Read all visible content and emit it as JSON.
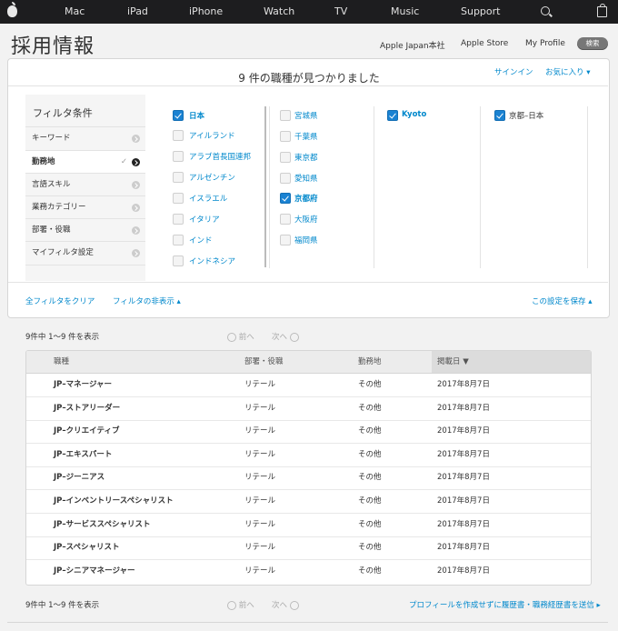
{
  "global_nav": {
    "items": [
      "Mac",
      "iPad",
      "iPhone",
      "Watch",
      "TV",
      "Music",
      "Support"
    ]
  },
  "header": {
    "title": "採用情報",
    "links": [
      "Apple Japan本社",
      "Apple Store",
      "My Profile"
    ],
    "search_button": "検索"
  },
  "results_header": {
    "count_text": "9 件の職種が見つかりました",
    "signin": "サインイン",
    "favorites": "お気に入り ▾"
  },
  "filters": {
    "title": "フィルタ条件",
    "categories": [
      {
        "label": "キーワード",
        "active": false
      },
      {
        "label": "勤務地",
        "active": true,
        "check": "✓"
      },
      {
        "label": "言語スキル",
        "active": false
      },
      {
        "label": "業務カテゴリー",
        "active": false
      },
      {
        "label": "部署・役職",
        "active": false
      },
      {
        "label": "マイフィルタ設定",
        "active": false
      }
    ],
    "countries": [
      {
        "label": "日本",
        "checked": true
      },
      {
        "label": "アイルランド",
        "checked": false
      },
      {
        "label": "アラブ首長国連邦",
        "checked": false
      },
      {
        "label": "アルゼンチン",
        "checked": false
      },
      {
        "label": "イスラエル",
        "checked": false
      },
      {
        "label": "イタリア",
        "checked": false
      },
      {
        "label": "インド",
        "checked": false
      },
      {
        "label": "インドネシア",
        "checked": false
      }
    ],
    "prefectures": [
      {
        "label": "宮城県",
        "checked": false
      },
      {
        "label": "千葉県",
        "checked": false
      },
      {
        "label": "東京都",
        "checked": false
      },
      {
        "label": "愛知県",
        "checked": false
      },
      {
        "label": "京都府",
        "checked": true
      },
      {
        "label": "大阪府",
        "checked": false
      },
      {
        "label": "福岡県",
        "checked": false
      }
    ],
    "city": {
      "label": "Kyoto",
      "checked": true
    },
    "selected": {
      "label": "京都–日本",
      "checked": true
    },
    "clear_all": "全フィルタをクリア",
    "hide_filters": "フィルタの非表示 ▴",
    "save_settings": "この設定を保存 ▴"
  },
  "pagination": {
    "summary": "9件中 1〜9 件を表示",
    "prev": "前へ",
    "next": "次へ"
  },
  "table": {
    "columns": [
      "職種",
      "部署・役職",
      "勤務地",
      "掲載日 ▼"
    ],
    "rows": [
      [
        "JP–マネージャー",
        "リテール",
        "その他",
        "2017年8月7日"
      ],
      [
        "JP–ストアリーダー",
        "リテール",
        "その他",
        "2017年8月7日"
      ],
      [
        "JP–クリエイティブ",
        "リテール",
        "その他",
        "2017年8月7日"
      ],
      [
        "JP–エキスパート",
        "リテール",
        "その他",
        "2017年8月7日"
      ],
      [
        "JP–ジーニアス",
        "リテール",
        "その他",
        "2017年8月7日"
      ],
      [
        "JP–インベントリースペシャリスト",
        "リテール",
        "その他",
        "2017年8月7日"
      ],
      [
        "JP–サービススペシャリスト",
        "リテール",
        "その他",
        "2017年8月7日"
      ],
      [
        "JP–スペシャリスト",
        "リテール",
        "その他",
        "2017年8月7日"
      ],
      [
        "JP–シニアマネージャー",
        "リテール",
        "その他",
        "2017年8月7日"
      ]
    ]
  },
  "footer": {
    "summary": "9件中 1〜9 件を表示",
    "prev": "前へ",
    "next": "次へ",
    "submit_link": "プロフィールを作成せずに履歴書・職務経歴書を送信 ▸"
  },
  "colors": {
    "link": "#0088cc",
    "checkbox": "#1a82d2",
    "nav_bg": "#1d1d1f"
  }
}
